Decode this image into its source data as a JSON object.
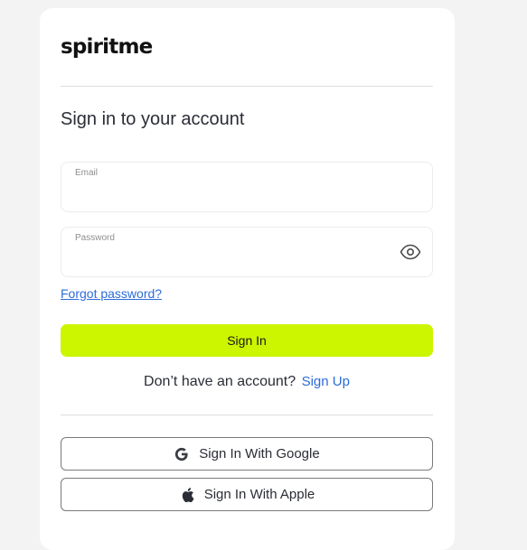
{
  "brand": {
    "logo_text": "spiritme"
  },
  "form": {
    "heading": "Sign in to your account",
    "email": {
      "label": "Email",
      "value": "",
      "placeholder": ""
    },
    "password": {
      "label": "Password",
      "value": "",
      "placeholder": ""
    },
    "forgot_password_label": "Forgot password?",
    "submit_label": "Sign In",
    "signup_prompt": "Don’t have an account?",
    "signup_link_label": "Sign Up"
  },
  "social": {
    "google_label": "Sign In With Google",
    "apple_label": "Sign In With Apple"
  },
  "icons": {
    "password_toggle": "eye-icon",
    "google": "google-icon",
    "apple": "apple-icon"
  },
  "colors": {
    "accent": "#ccf500",
    "link": "#2b6cd8",
    "background": "#f3f3f3",
    "card": "#ffffff"
  }
}
